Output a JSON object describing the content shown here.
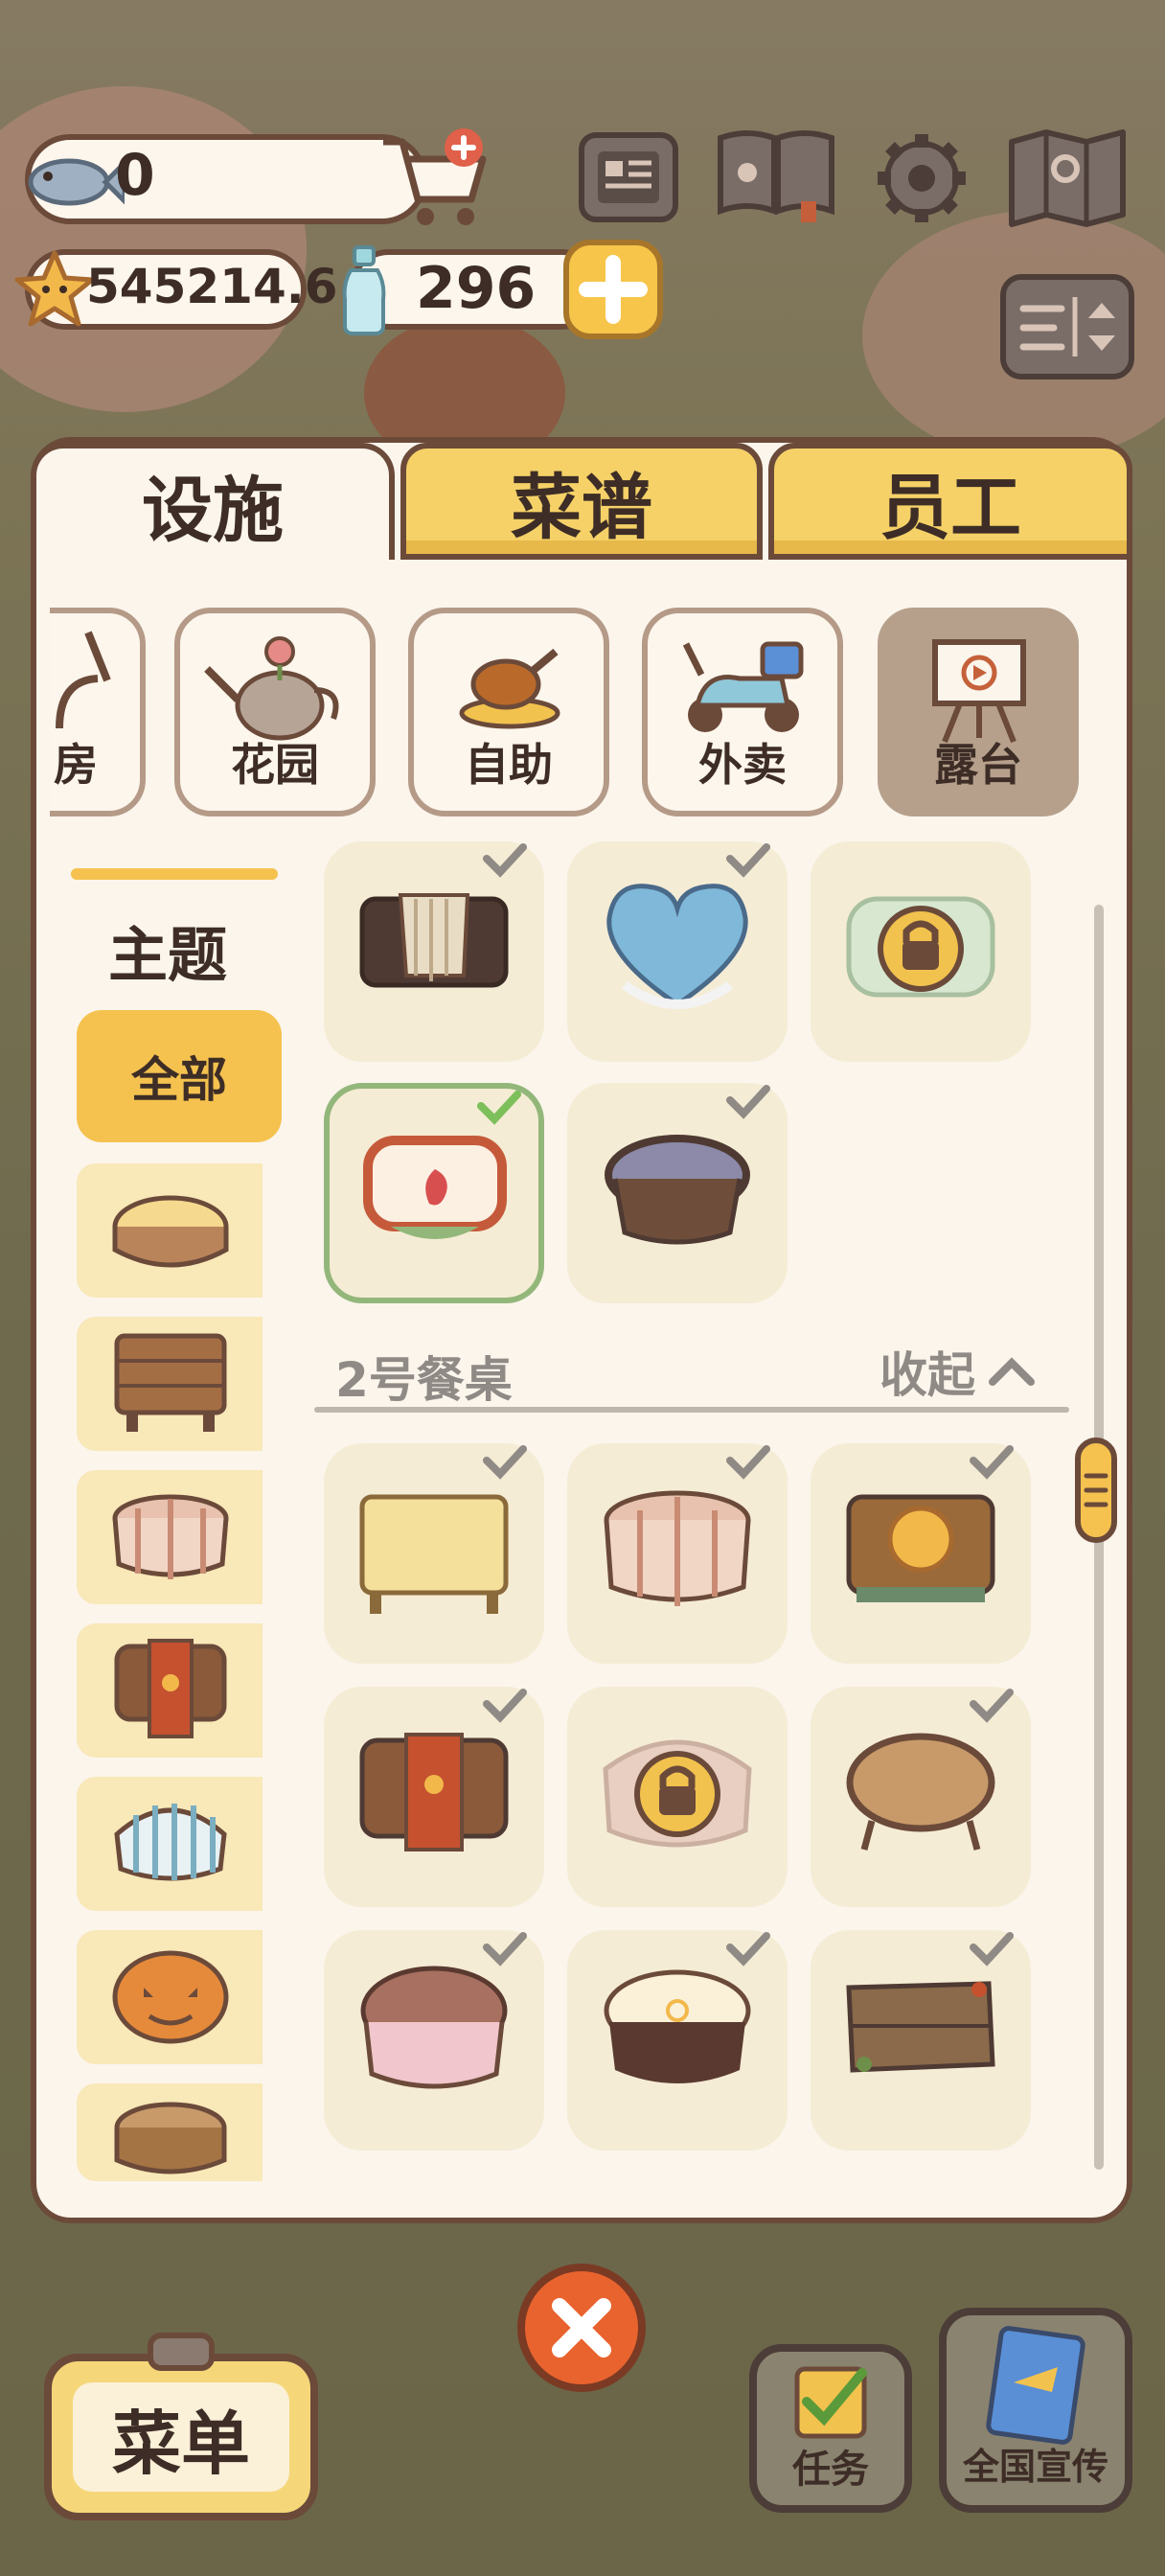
{
  "currency": {
    "fish": "0",
    "stars": "545214.6",
    "bottles": "296"
  },
  "tabs": [
    {
      "label": "设施",
      "active": true
    },
    {
      "label": "菜谱",
      "active": false
    },
    {
      "label": "员工",
      "active": false
    }
  ],
  "categories": [
    {
      "label": "房",
      "icon": "kitchen-icon"
    },
    {
      "label": "花园",
      "icon": "watering-can-icon"
    },
    {
      "label": "自助",
      "icon": "buffet-icon"
    },
    {
      "label": "外卖",
      "icon": "scooter-icon"
    },
    {
      "label": "露台",
      "icon": "easel-icon",
      "active": true
    }
  ],
  "sidebar": {
    "title": "主题",
    "all_label": "全部"
  },
  "section": {
    "title": "2号餐桌",
    "collapse_label": "收起"
  },
  "bottom": {
    "menu_label": "菜单",
    "tasks_label": "任务",
    "promo_label": "全国宣传"
  },
  "colors": {
    "accent_yellow": "#f5c24f",
    "panel_bg": "#fbf5ec",
    "card_bg": "#f5ecd5",
    "border_brown": "#6b4a3a",
    "close_red": "#e8632e",
    "selected_green": "#93b77a"
  }
}
